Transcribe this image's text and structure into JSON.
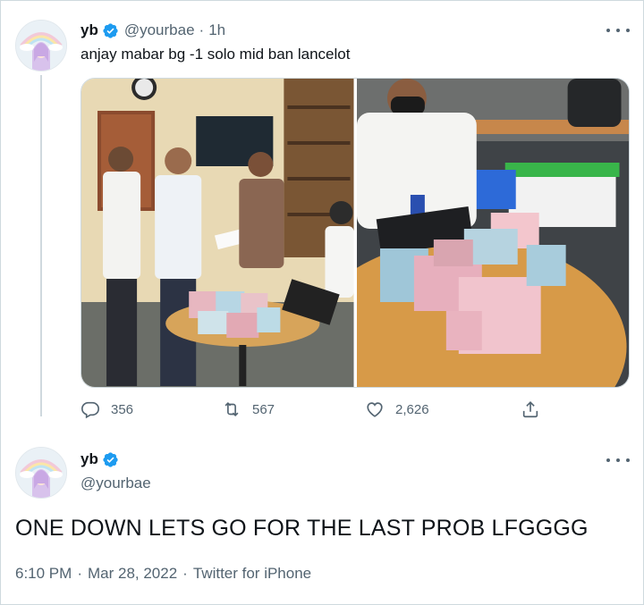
{
  "tweet1": {
    "name": "yb",
    "handle": "@yourbae",
    "time": "1h",
    "text": "anjay mabar bg -1 solo mid ban lancelot",
    "stats": {
      "replies": "356",
      "retweets": "567",
      "likes": "2,626"
    }
  },
  "tweet2": {
    "name": "yb",
    "handle": "@yourbae",
    "text": "ONE DOWN LETS GO FOR THE LAST PROB LFGGGG",
    "time": "6:10 PM",
    "date": "Mar 28, 2022",
    "source": "Twitter for iPhone"
  },
  "icons": {
    "verified": "verified-badge-icon",
    "more": "more-icon",
    "reply": "reply-icon",
    "retweet": "retweet-icon",
    "like": "like-icon",
    "share": "share-icon"
  },
  "colors": {
    "verified": "#1d9bf0",
    "secondary_text": "#536471",
    "border": "#cfd9de"
  }
}
